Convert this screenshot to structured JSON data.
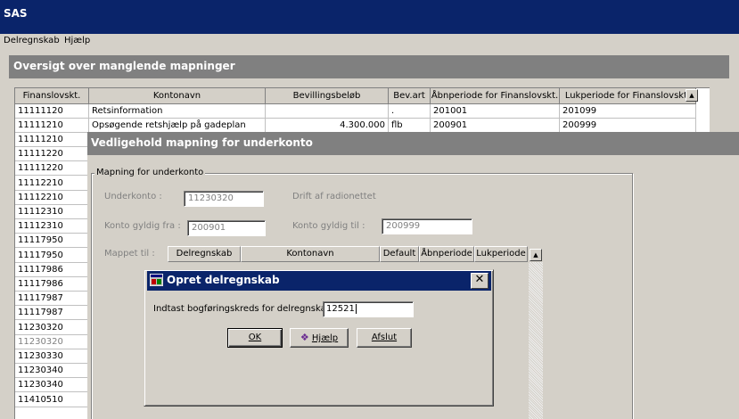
{
  "app": {
    "title": "SAS"
  },
  "menu": {
    "items": [
      "Delregnskab",
      "Hjælp"
    ]
  },
  "oversigt": {
    "title": "Oversigt over manglende mapninger",
    "columns": [
      "Finanslovskt.",
      "Kontonavn",
      "Bevillingsbeløb",
      "Bev.art",
      "Åbnperiode for Finanslovskt.",
      "Lukperiode for Finanslovskt."
    ],
    "rows": [
      [
        "11111120",
        "Retsinformation",
        "",
        ".",
        "201001",
        "201099"
      ],
      [
        "11111210",
        "Opsøgende retshjælp på gadeplan",
        "4.300.000",
        "flb",
        "200901",
        "200999"
      ]
    ],
    "codes": [
      "11111210",
      "11111220",
      "11111220",
      "11112210",
      "11112210",
      "11112310",
      "11112310",
      "11117950",
      "11117950",
      "11117986",
      "11117986",
      "11117987",
      "11117987",
      "11230320",
      "11230320",
      "11230330",
      "11230340",
      "11230340",
      "11410510"
    ]
  },
  "vedligehold": {
    "title": "Vedligehold mapning for underkonto",
    "group_label": "Mapning for underkonto",
    "underkonto_label": "Underkonto :",
    "underkonto_value": "11230320",
    "underkonto_name": "Drift af radionettet",
    "gyldig_fra_label": "Konto gyldig fra :",
    "gyldig_fra_value": "200901",
    "gyldig_til_label": "Konto gyldig til :",
    "gyldig_til_value": "200999",
    "mappet_label": "Mappet til :",
    "columns": [
      "Delregnskab",
      "Kontonavn",
      "Default",
      "Åbnperiode",
      "Lukperiode"
    ]
  },
  "dialog": {
    "title": "Opret delregnskab",
    "prompt": "Indtast bogføringskreds for delregnskab:",
    "input_value": "12521",
    "ok_label": "OK",
    "help_label": "Hjælp",
    "exit_label": "Afslut"
  },
  "colors": {
    "titlebar": "#0a246a",
    "inactive_title": "#808080",
    "face": "#d4d0c8"
  }
}
